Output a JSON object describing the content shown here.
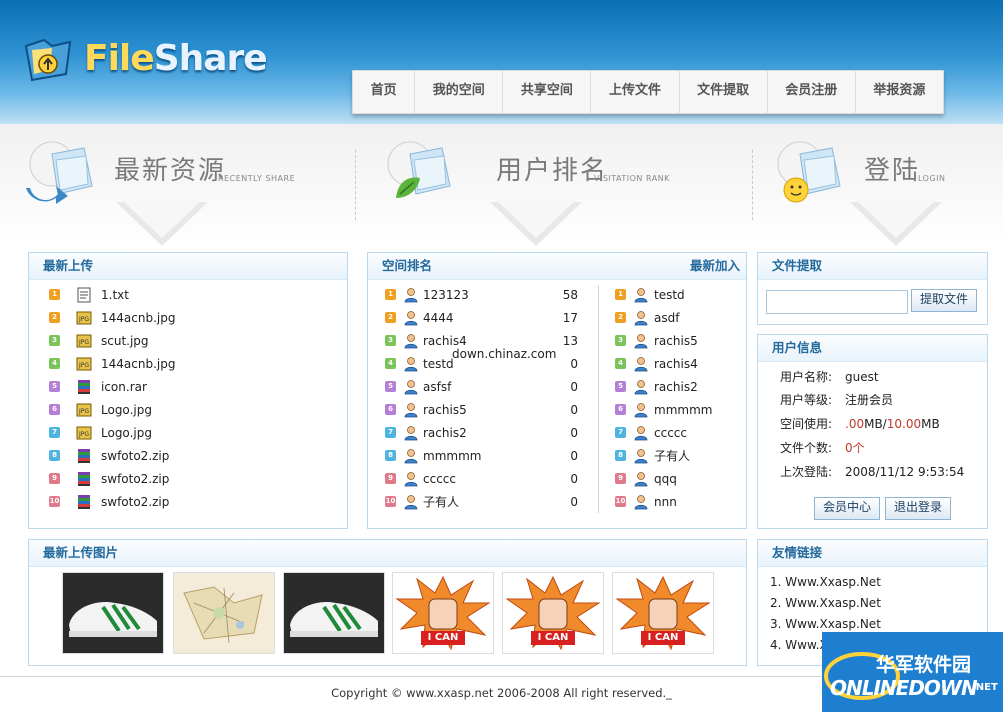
{
  "brand": {
    "name_part1": "File",
    "name_part2": "Share"
  },
  "nav": [
    "首页",
    "我的空间",
    "共享空间",
    "上传文件",
    "文件提取",
    "会员注册",
    "举报资源"
  ],
  "band": [
    {
      "title": "最新资源",
      "subtitle": "RECENTLY SHARE"
    },
    {
      "title": "用户排名",
      "subtitle": "VISITATION RANK"
    },
    {
      "title": "登陆",
      "subtitle": "LOGIN"
    }
  ],
  "latest_upload": {
    "title": "最新上传",
    "items": [
      {
        "num": "1",
        "name": "1.txt",
        "icon": "txt-file-icon"
      },
      {
        "num": "2",
        "name": "144acnb.jpg",
        "icon": "jpg-file-icon"
      },
      {
        "num": "3",
        "name": "scut.jpg",
        "icon": "jpg-file-icon"
      },
      {
        "num": "4",
        "name": "144acnb.jpg",
        "icon": "jpg-file-icon"
      },
      {
        "num": "5",
        "name": "icon.rar",
        "icon": "archive-file-icon"
      },
      {
        "num": "6",
        "name": "Logo.jpg",
        "icon": "jpg-file-icon"
      },
      {
        "num": "7",
        "name": "Logo.jpg",
        "icon": "jpg-file-icon"
      },
      {
        "num": "8",
        "name": "swfoto2.zip",
        "icon": "archive-file-icon"
      },
      {
        "num": "9",
        "name": "swfoto2.zip",
        "icon": "archive-file-icon"
      },
      {
        "num": "10",
        "name": "swfoto2.zip",
        "icon": "archive-file-icon"
      }
    ]
  },
  "ranking": {
    "title": "空间排名",
    "newest_title": "最新加入",
    "items": [
      {
        "num": "1",
        "name": "123123",
        "score": "58"
      },
      {
        "num": "2",
        "name": "4444",
        "score": "17"
      },
      {
        "num": "3",
        "name": "rachis4",
        "score": "13"
      },
      {
        "num": "4",
        "name": "testd",
        "score": "0"
      },
      {
        "num": "5",
        "name": "asfsf",
        "score": "0"
      },
      {
        "num": "6",
        "name": "rachis5",
        "score": "0"
      },
      {
        "num": "7",
        "name": "rachis2",
        "score": "0"
      },
      {
        "num": "8",
        "name": "mmmmm",
        "score": "0"
      },
      {
        "num": "9",
        "name": "ccccc",
        "score": "0"
      },
      {
        "num": "10",
        "name": "子有人",
        "score": "0"
      }
    ],
    "newest": [
      {
        "num": "1",
        "name": "testd"
      },
      {
        "num": "2",
        "name": "asdf"
      },
      {
        "num": "3",
        "name": "rachis5"
      },
      {
        "num": "4",
        "name": "rachis4"
      },
      {
        "num": "5",
        "name": "rachis2"
      },
      {
        "num": "6",
        "name": "mmmmm"
      },
      {
        "num": "7",
        "name": "ccccc"
      },
      {
        "num": "8",
        "name": "子有人"
      },
      {
        "num": "9",
        "name": "qqq"
      },
      {
        "num": "10",
        "name": "nnn"
      }
    ]
  },
  "file_extract": {
    "title": "文件提取",
    "input_value": "",
    "button": "提取文件"
  },
  "user_info": {
    "title": "用户信息",
    "name_label": "用户名称:",
    "name_value": "guest",
    "level_label": "用户等级:",
    "level_value": "注册会员",
    "space_label": "空间使用:",
    "space_used": ".00",
    "space_unit1": "MB/",
    "space_total": "10.00",
    "space_unit2": "MB",
    "files_label": "文件个数:",
    "files_value": "0",
    "files_unit": "个",
    "last_label": "上次登陆:",
    "last_value": "2008/11/12 9:53:54",
    "btn_center": "会员中心",
    "btn_logout": "退出登录"
  },
  "latest_images": {
    "title": "最新上传图片",
    "images": [
      "sneaker-photo",
      "map-photo",
      "sneaker-photo",
      "i-can-fist-image",
      "i-can-fist-image",
      "i-can-fist-image"
    ],
    "ican_text": "I CAN"
  },
  "friend_links": {
    "title": "友情链接",
    "links": [
      "1. Www.Xxasp.Net",
      "2. Www.Xxasp.Net",
      "3. Www.Xxasp.Net",
      "4. Www.Xxasp.Net"
    ]
  },
  "watermark": "down.chinaz.com",
  "footer": "Copyright © www.xxasp.net 2006-2008 All right reserved._",
  "site_badge": {
    "cn": "华军软件园",
    "en": "ONLINEDOWN",
    "suffix": ".NET"
  },
  "colors": {
    "link_blue": "#246a9c",
    "accent_red": "#c0392b",
    "badge_orange": "#f0a020"
  }
}
